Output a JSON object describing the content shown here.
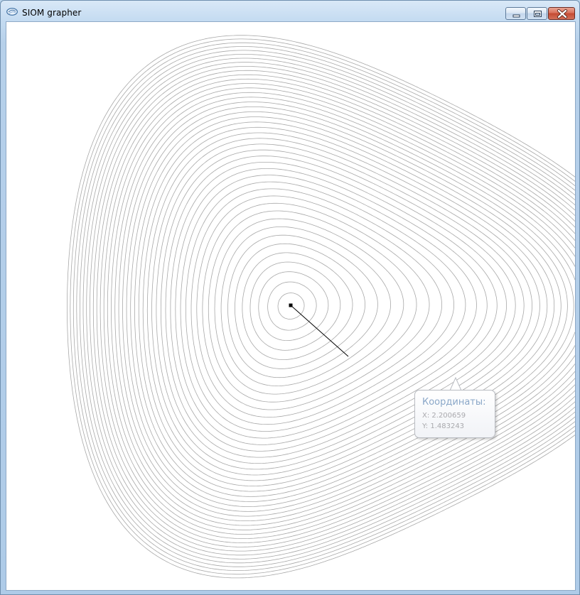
{
  "window": {
    "title": "SIOM grapher",
    "app_icon": "grapher-app-icon",
    "controls": {
      "minimize_icon": "minimize-icon",
      "maximize_icon": "maximize-icon",
      "close_icon": "close-icon"
    }
  },
  "plot": {
    "contour_color": "#a8a8a8",
    "path_color": "#000000",
    "marker_icon": "square-marker"
  },
  "tooltip": {
    "heading": "Координаты:",
    "x_line": "X: 2.200659",
    "y_line": "Y: 1.483243"
  },
  "colors": {
    "title_bar": "#c4dbf1",
    "close_button": "#c44a31",
    "tooltip_heading": "#8aa7c8"
  }
}
